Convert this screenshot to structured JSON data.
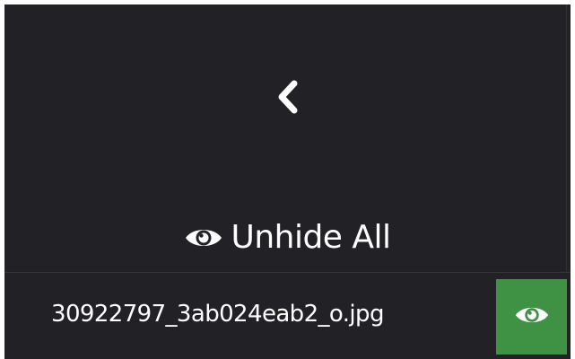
{
  "panel": {
    "back_icon": "chevron-left-icon",
    "unhide_all": {
      "icon": "eye-icon",
      "label": "Unhide All"
    },
    "hidden_files": [
      {
        "name": "30922797_3ab024eab2_o.jpg",
        "action_icon": "eye-icon",
        "action_color": "#3f9244"
      }
    ]
  },
  "colors": {
    "background": "#222226",
    "text": "#ffffff",
    "accent_green": "#3f9244"
  }
}
